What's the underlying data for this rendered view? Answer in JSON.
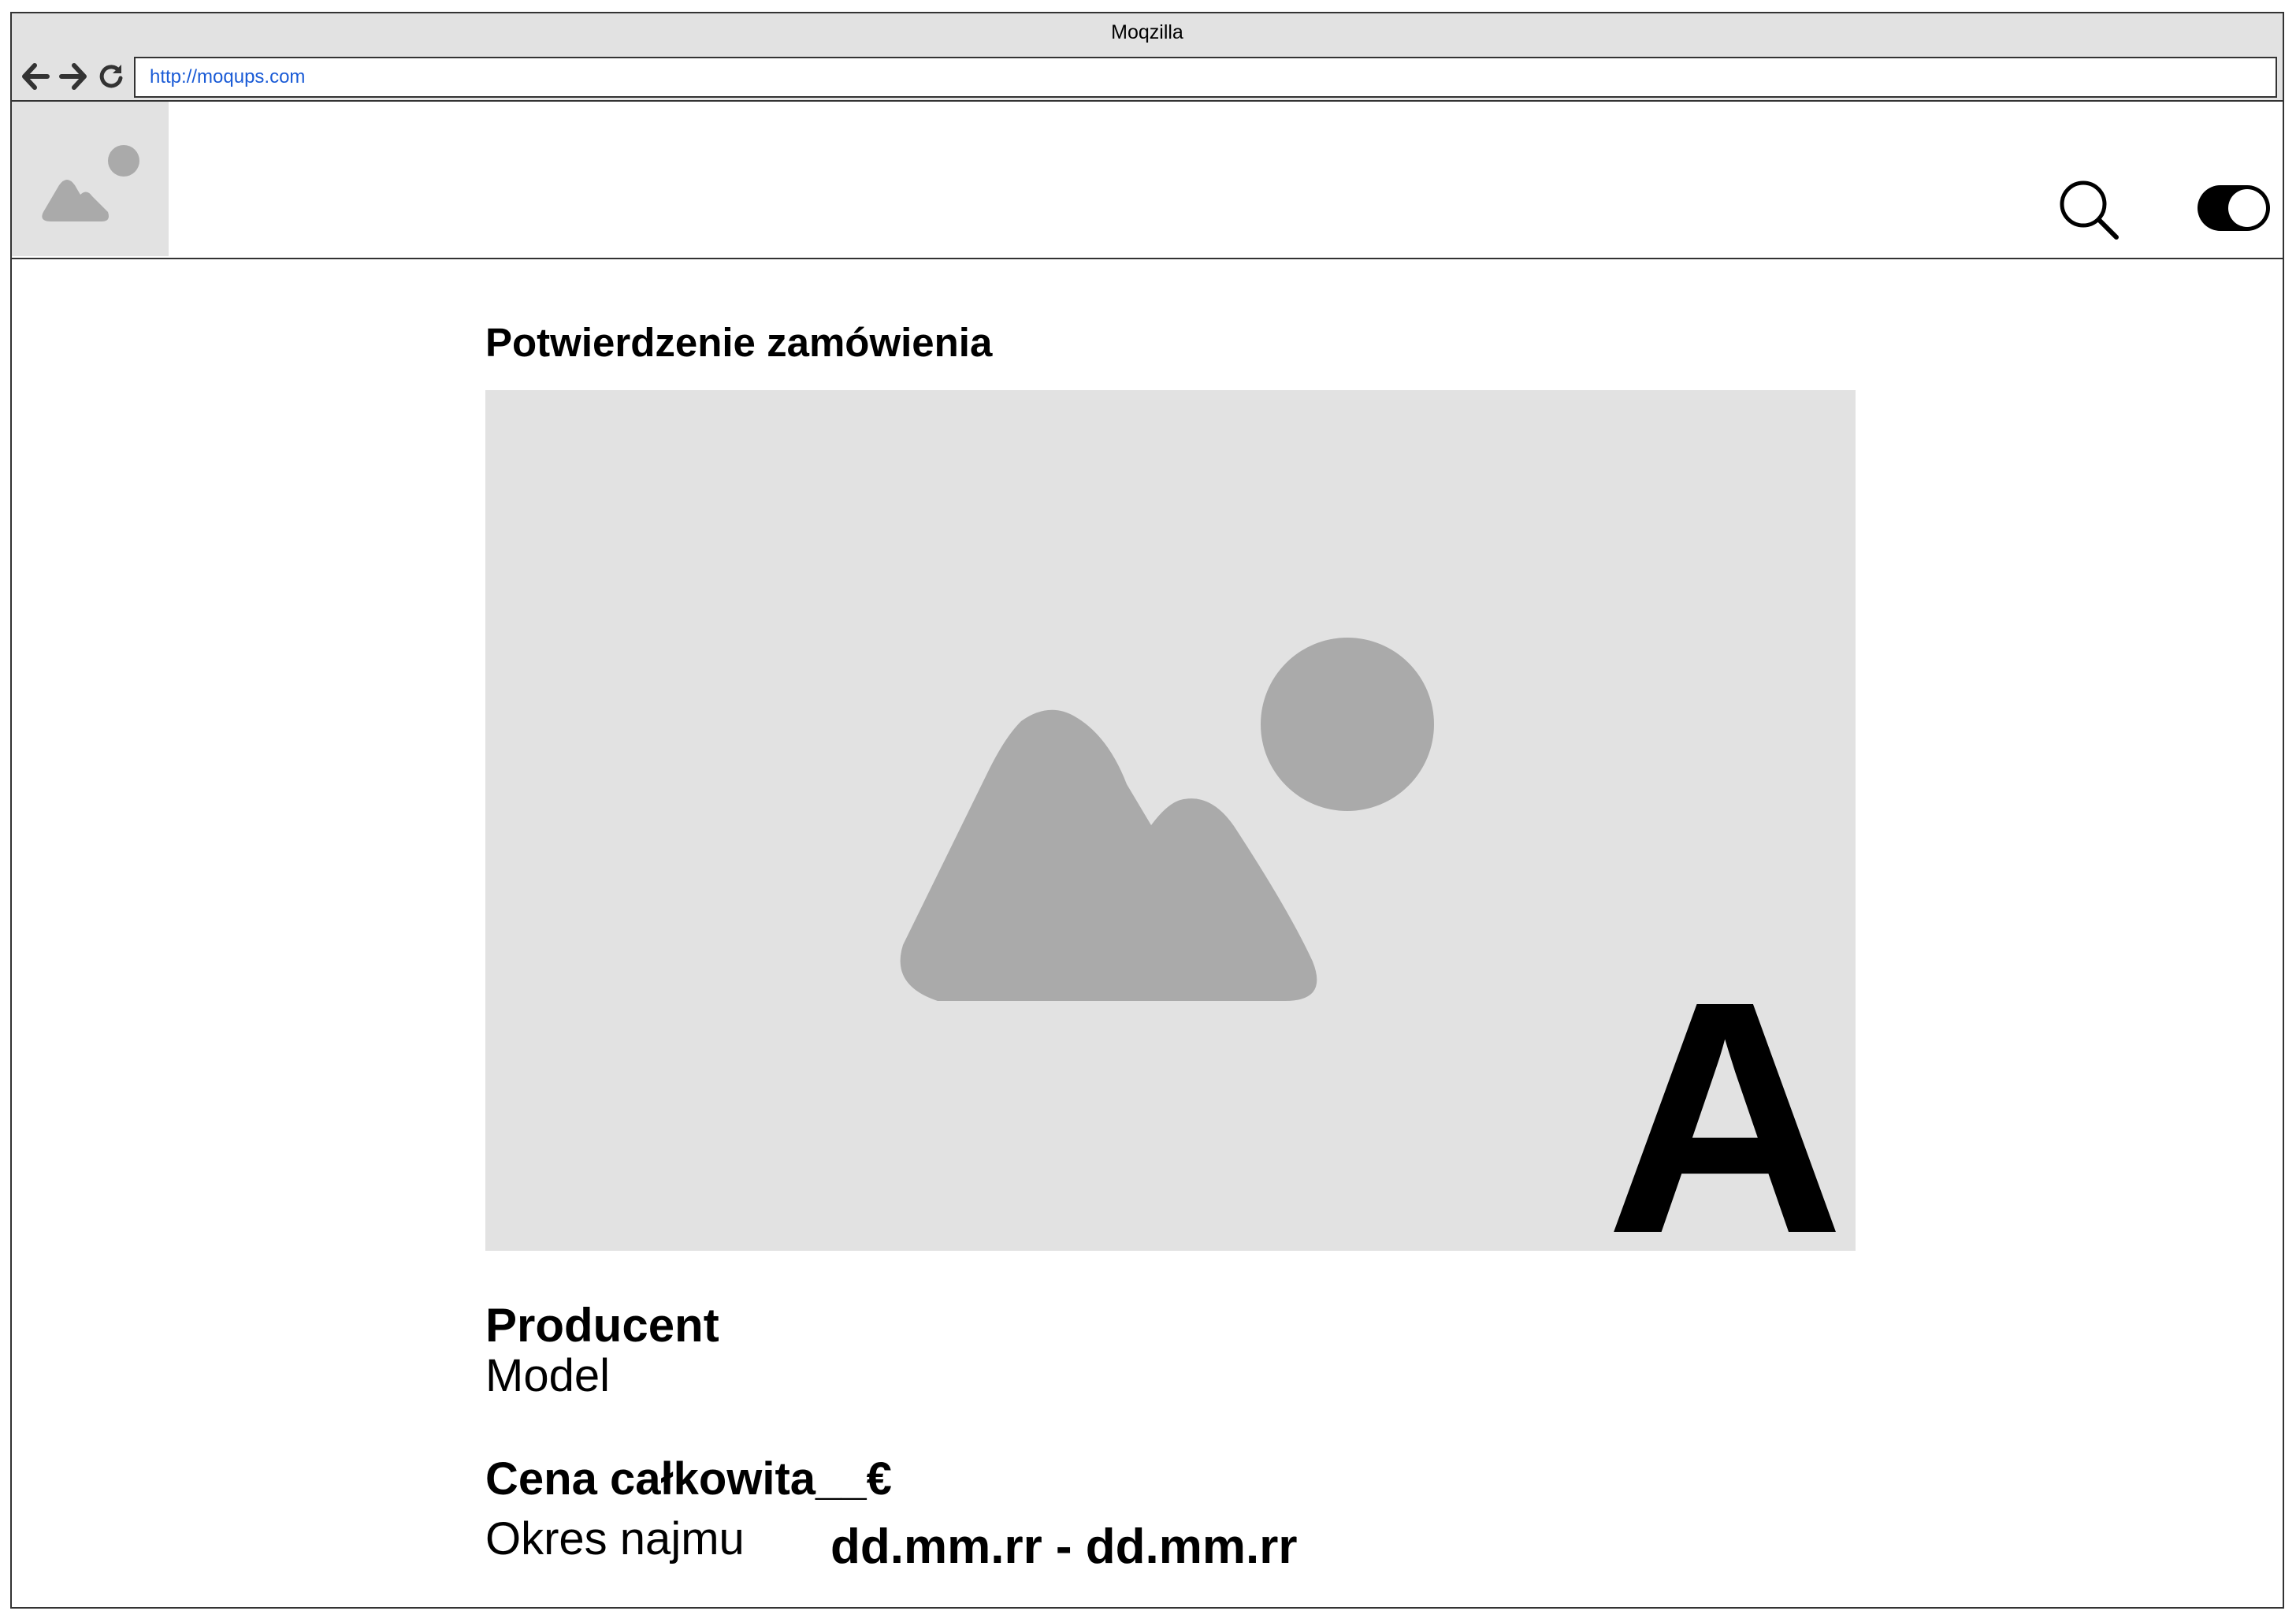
{
  "window": {
    "title": "Moqzilla",
    "url": "http://moqups.com"
  },
  "nav": {
    "back_icon": "arrow-left-icon",
    "forward_icon": "arrow-right-icon",
    "reload_icon": "reload-icon"
  },
  "header": {
    "logo_icon": "image-placeholder-icon",
    "search_icon": "search-icon",
    "toggle_state": "on"
  },
  "main": {
    "title": "Potwierdzenie zamówienia",
    "hero_icon": "image-placeholder-icon",
    "hero_letter": "A",
    "producer": "Producent",
    "model": "Model",
    "price": "Cena całkowita__€",
    "period_label": "Okres najmu",
    "period_value": "dd.mm.rr - dd.mm.rr"
  },
  "colors": {
    "chrome": "#e2e2e2",
    "placeholder": "#aaaaaa",
    "link": "#1a5bd6",
    "text": "#000000"
  }
}
